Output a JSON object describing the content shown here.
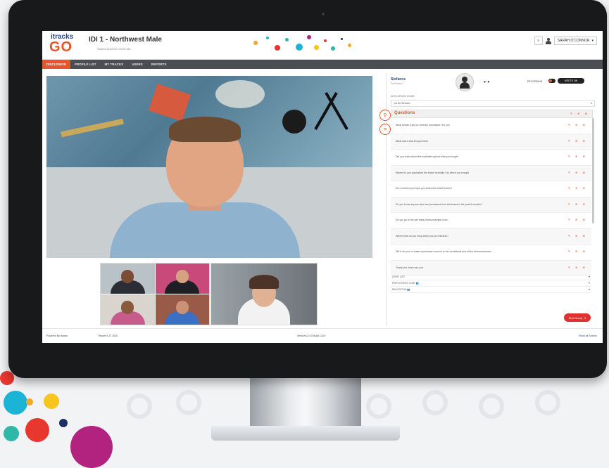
{
  "app": {
    "logo_top": "itracks",
    "logo_bottom": "GO",
    "session_title": "IDI 1 - Northwest Male",
    "session_subtitle": "Started 5/3/2020 10:50 AM",
    "user_name": "SARAH O'CONNOR"
  },
  "nav": {
    "items": [
      {
        "label": "DISCUSSION",
        "active": true
      },
      {
        "label": "PROFILE LIST",
        "active": false
      },
      {
        "label": "MY TRACKS",
        "active": false
      },
      {
        "label": "USERS",
        "active": false
      },
      {
        "label": "REPORTS",
        "active": false
      }
    ]
  },
  "right_panel": {
    "participant_name": "Stefanos",
    "participant_status": "Participant",
    "recording_label": "RECORDING",
    "recording_button": "MEETS ON",
    "guide_label": "DISCUSSION GUIDE",
    "guide_value": "1st IDI Session",
    "questions_title": "Questions",
    "questions": [
      "What is/was it you've recently purchased? for you",
      "What was it that led you there",
      "Did you know about the available options that you bought",
      "Where do you purchased the brand normally? do which you bought",
      "Do I mention you have you heard the brand before?",
      "Do you know anyone who has purchased from this brand in the past 6 months?",
      "Do you go to the site https://www.example.com/.",
      "Where else do you shop when you do research?",
      "Did it do your or make a purchase connect to the conditional and all the aforementioned",
      "Thank you when can you"
    ],
    "bottom_rows": [
      "USER LIST",
      "PARTICIPANT CHAT",
      "BACKROOM"
    ],
    "end_button": "End Group"
  },
  "footer": {
    "left": "Powered By itracks",
    "left2": "Report 5.27.2020",
    "center": "Version v2.0.0 Build 1234",
    "right": "Show all Section"
  },
  "colors": {
    "accent": "#e8542b",
    "nav_bg": "#4a4d51",
    "logo_blue": "#2d4b7a",
    "end_button": "#e03030"
  }
}
